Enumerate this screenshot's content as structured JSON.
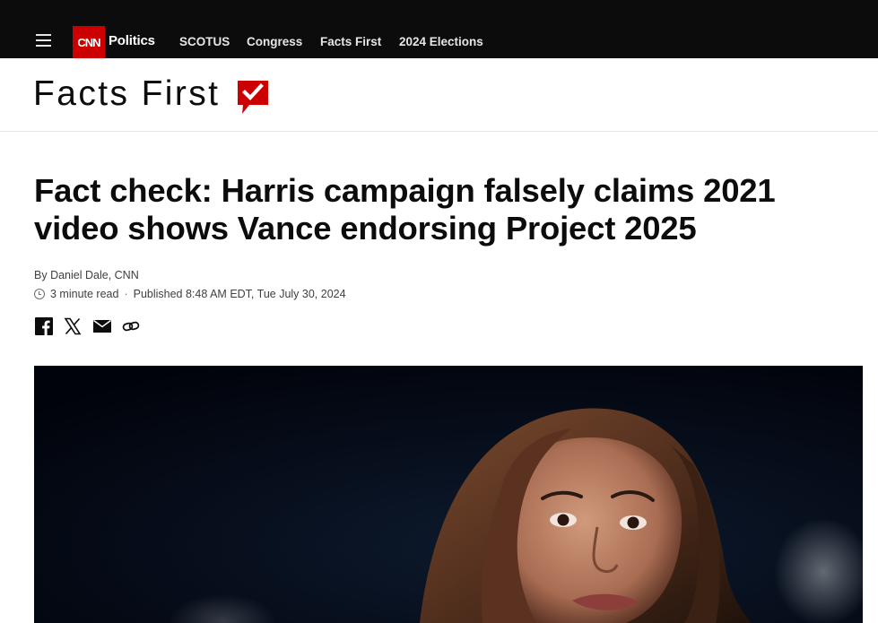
{
  "header": {
    "logo_text": "CNN",
    "section": "Politics",
    "nav": [
      "SCOTUS",
      "Congress",
      "Facts First",
      "2024 Elections"
    ]
  },
  "brand": {
    "facts_first": "Facts First",
    "accent_color": "#cc0000"
  },
  "article": {
    "headline": "Fact check: Harris campaign falsely claims 2021 video shows Vance endorsing Project 2025",
    "byline_prefix": "By ",
    "author": "Daniel Dale",
    "outlet": ", CNN",
    "read_time": "3 minute read",
    "separator": "·",
    "published": "Published 8:48 AM EDT, Tue July 30, 2024"
  },
  "share_icons": [
    "facebook-icon",
    "x-icon",
    "email-icon",
    "link-icon"
  ],
  "colors": {
    "topbar": "#0c0c0c",
    "text": "#0c0c0c",
    "meta": "#404040"
  }
}
